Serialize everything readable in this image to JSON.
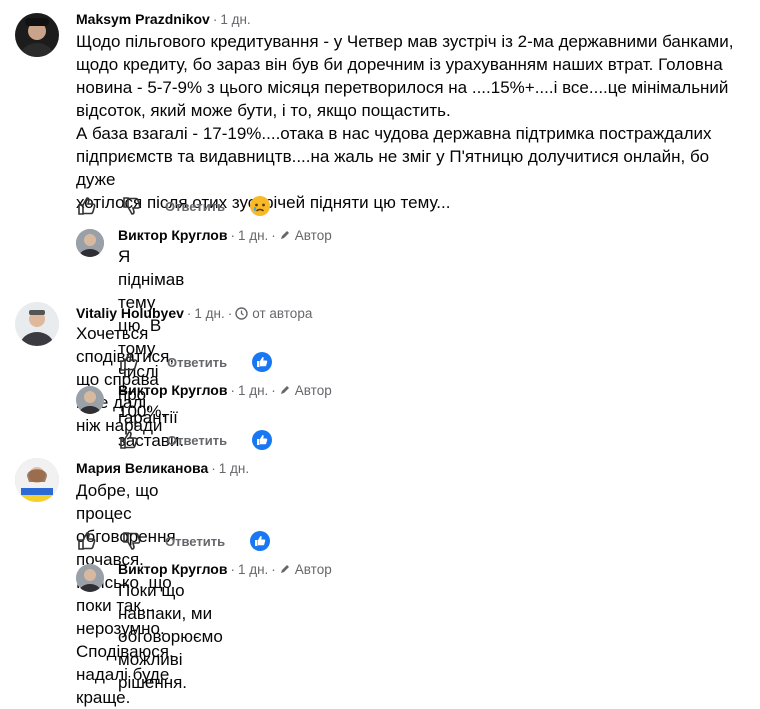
{
  "comments": [
    {
      "name": "Maksym Prazdnikov",
      "time": "1 дн.",
      "text": "Щодо пільгового кредитування - у Четвер мав зустріч із 2-ма державними банками,\nщодо кредиту, бо зараз він був би доречним із урахуванням наших втрат. Головна\nновина - 5-7-9% з цього місяця перетворилося на ....15%+....і все....це мінімальний\nвідсоток, який може бути, і то, якщо пощастить.\nА база взагалі - 17-19%....отака в нас чудова державна підтримка постраждалих\nпідприємств та видавництв....на жаль не зміг у П'ятницю долучитися онлайн, бо дуже\nхотілося після отих зустрічей підняти цю тему...",
      "reply_label": "Ответить",
      "reaction": "sad-reaction"
    },
    {
      "name": "Виктор Круглов",
      "time": "1 дн.",
      "badge": "Автор",
      "text": "Я піднімав тему цю. В тому числі про гарантії застави."
    },
    {
      "name": "Vitaliy Holubyev",
      "time": "1 дн.",
      "badge": "от автора",
      "text": "Хочеться сподіватися, що справа піде далі, ніж наради",
      "reply_label": "Ответить",
      "reaction": "like-reaction"
    },
    {
      "name": "Виктор Круглов",
      "time": "1 дн.",
      "badge": "Автор",
      "text": "100%.",
      "reply_label": "Ответить",
      "reaction": "like-reaction"
    },
    {
      "name": "Мария Великанова",
      "time": "1 дн.",
      "text": "Добре, що процес обговорення почався. Кепсько, що поки так... нерозумно.\nСподіваюся, надалі буде краще.",
      "reply_label": "Ответить",
      "reaction": "like-reaction"
    },
    {
      "name": "Виктор Круглов",
      "time": "1 дн.",
      "badge": "Автор",
      "text": "Поки що навпаки, ми обговорюємо можливі рішення."
    }
  ],
  "colors": {
    "like_blue": "#1877f2",
    "sad_yellow": "#f7b928",
    "meta_gray": "#65676b"
  }
}
